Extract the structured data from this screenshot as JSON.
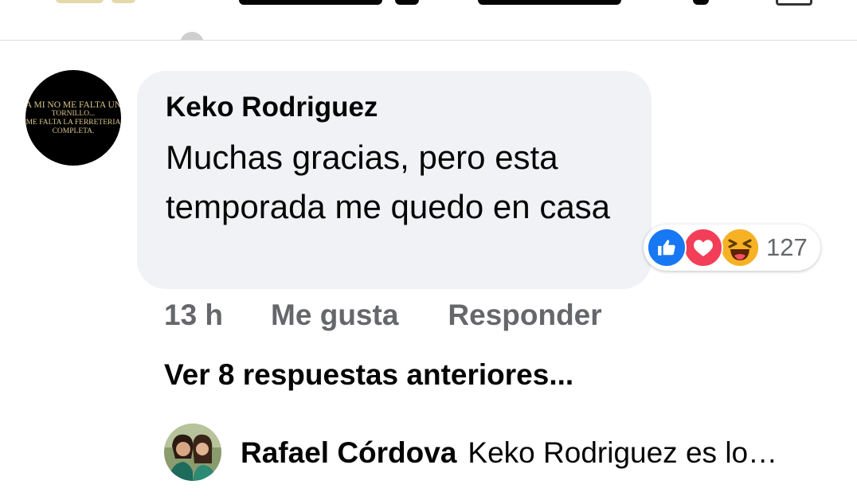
{
  "comment": {
    "avatar_lines": [
      "A MI NO ME FALTA UN",
      "TORNILLO...",
      "ME FALTA LA FERRETERIA",
      "COMPLETA."
    ],
    "author": "Keko Rodriguez",
    "text": "Muchas gracias, pero esta temporada me quedo en casa",
    "reactions": {
      "icons": [
        "like-icon",
        "love-icon",
        "haha-icon"
      ],
      "count": "127"
    },
    "actions": {
      "time": "13 h",
      "like_label": "Me gusta",
      "reply_label": "Responder"
    }
  },
  "view_more_label": "Ver 8 respuestas anteriores...",
  "reply": {
    "author": "Rafael Córdova",
    "preview": "Keko Rodriguez es lo…"
  },
  "colors": {
    "bubble": "#f0f2f5",
    "secondary_text": "#65676b",
    "like": "#1877f2",
    "love": "#f33e58",
    "haha": "#f7b125"
  }
}
